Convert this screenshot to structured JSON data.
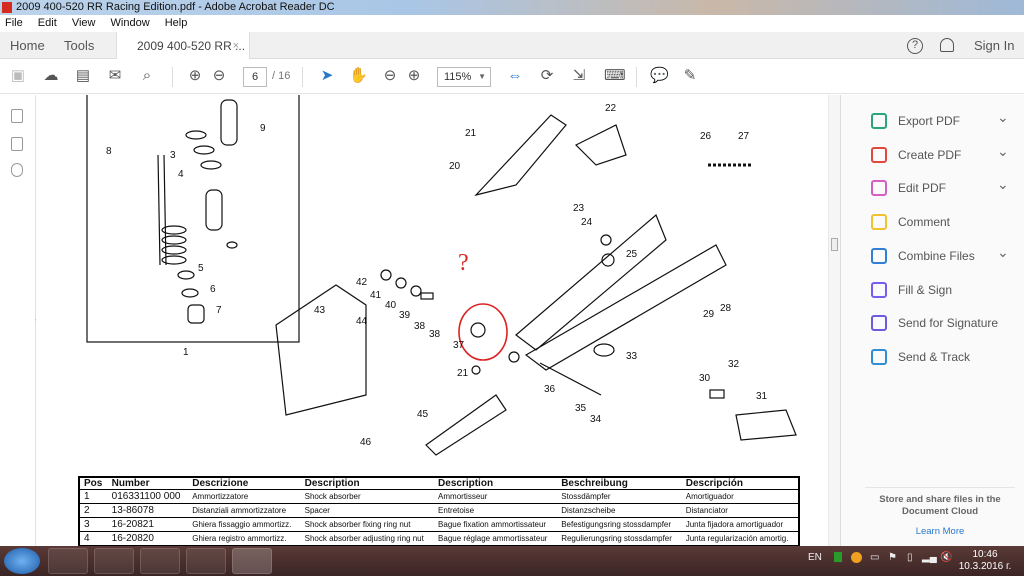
{
  "window": {
    "title": "2009 400-520 RR Racing Edition.pdf - Adobe Acrobat Reader DC"
  },
  "menu": [
    "File",
    "Edit",
    "View",
    "Window",
    "Help"
  ],
  "tabs": {
    "home": "Home",
    "tools": "Tools",
    "document": "2009 400-520 RR ...",
    "close": "×"
  },
  "header": {
    "help": "?",
    "sign_in": "Sign In"
  },
  "toolbar": {
    "page_current": "6",
    "page_total": "/ 16",
    "zoom": "115%"
  },
  "right_panel": {
    "items": [
      {
        "label": "Export PDF",
        "color": "#2aa57a",
        "chevron": true
      },
      {
        "label": "Create PDF",
        "color": "#e0483e",
        "chevron": true
      },
      {
        "label": "Edit PDF",
        "color": "#d35ec8",
        "chevron": true
      },
      {
        "label": "Comment",
        "color": "#f2c12e",
        "chevron": false
      },
      {
        "label": "Combine Files",
        "color": "#2f7fd6",
        "chevron": true
      },
      {
        "label": "Fill & Sign",
        "color": "#7a5cf0",
        "chevron": false
      },
      {
        "label": "Send for Signature",
        "color": "#6a5cdc",
        "chevron": false
      },
      {
        "label": "Send & Track",
        "color": "#2f8fd6",
        "chevron": false
      }
    ],
    "cloud_text": "Store and share files in the Document Cloud",
    "learn_more": "Learn More"
  },
  "diagram": {
    "labels": [
      "21",
      "22",
      "20",
      "26",
      "27",
      "9",
      "8",
      "3",
      "4",
      "23",
      "24",
      "25",
      "5",
      "6",
      "7",
      "42",
      "41",
      "40",
      "39",
      "38",
      "38",
      "37",
      "43",
      "44",
      "29",
      "28",
      "33",
      "32",
      "21",
      "36",
      "30",
      "31",
      "35",
      "34",
      "45",
      "46",
      "1"
    ],
    "annotation": "?"
  },
  "table": {
    "headers": [
      "Pos",
      "Number",
      "Descrizione",
      "Description",
      "Description",
      "Beschreibung",
      "Descripción"
    ],
    "rows": [
      [
        "1",
        "016331100 000",
        "Ammortizzatore",
        "Shock absorber",
        "Ammortisseur",
        "Stossdämpfer",
        "Amortiguador"
      ],
      [
        "2",
        "13-86078",
        "Distanziali ammortizzatore",
        "Spacer",
        "Entretoise",
        "Distanzscheibe",
        "Distanciator"
      ],
      [
        "3",
        "16-20821",
        "Ghiera fissaggio ammortizz.",
        "Shock absorber fixing ring nut",
        "Bague fixation ammortissateur",
        "Befestigungsring stossdampfer",
        "Junta fijadora amortiguador"
      ],
      [
        "4",
        "16-20820",
        "Ghiera registro ammortizz.",
        "Shock absorber adjusting ring nut",
        "Bague réglage ammortissateur",
        "Regulierungsring stossdampfer",
        "Junta regularización amortig."
      ]
    ]
  },
  "taskbar": {
    "lang": "EN",
    "time": "10:46",
    "date": "10.3.2016 г."
  }
}
